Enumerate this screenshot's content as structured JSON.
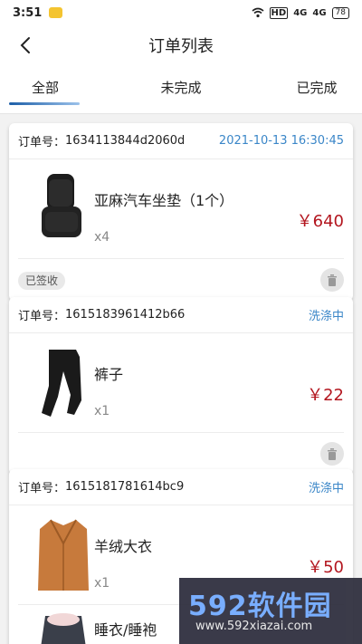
{
  "status_bar": {
    "time": "3:51",
    "network_label": "HD",
    "signal1": "4G",
    "signal2": "4G",
    "battery": "78"
  },
  "header": {
    "title": "订单列表"
  },
  "tabs": [
    {
      "label": "全部",
      "active": true
    },
    {
      "label": "未完成",
      "active": false
    },
    {
      "label": "已完成",
      "active": false
    }
  ],
  "orders": [
    {
      "order_label": "订单号：",
      "order_no": "1634113844d2060d",
      "status": "2021-10-13 16:30:45",
      "item_name": "亚麻汽车坐垫（1个）",
      "quantity": "x4",
      "price": "￥640",
      "badge": "已签收",
      "icon": "car-seat-cushion"
    },
    {
      "order_label": "订单号：",
      "order_no": "1615183961412b66",
      "status": "洗涤中",
      "item_name": "裤子",
      "quantity": "x1",
      "price": "￥22",
      "badge": "",
      "icon": "pants"
    },
    {
      "order_label": "订单号：",
      "order_no": "1615181781614bc9",
      "status": "洗涤中",
      "item_name": "羊绒大衣",
      "quantity": "x1",
      "price": "￥50",
      "badge": "",
      "icon": "coat"
    },
    {
      "item_name": "睡衣/睡袍",
      "icon": "pajamas"
    }
  ],
  "watermark": {
    "big": "592软件园",
    "small": "www.592xiazai.com"
  },
  "colors": {
    "accent": "#3a86c8",
    "price": "#b3161f",
    "tab_indicator": "#1d5fa8"
  }
}
